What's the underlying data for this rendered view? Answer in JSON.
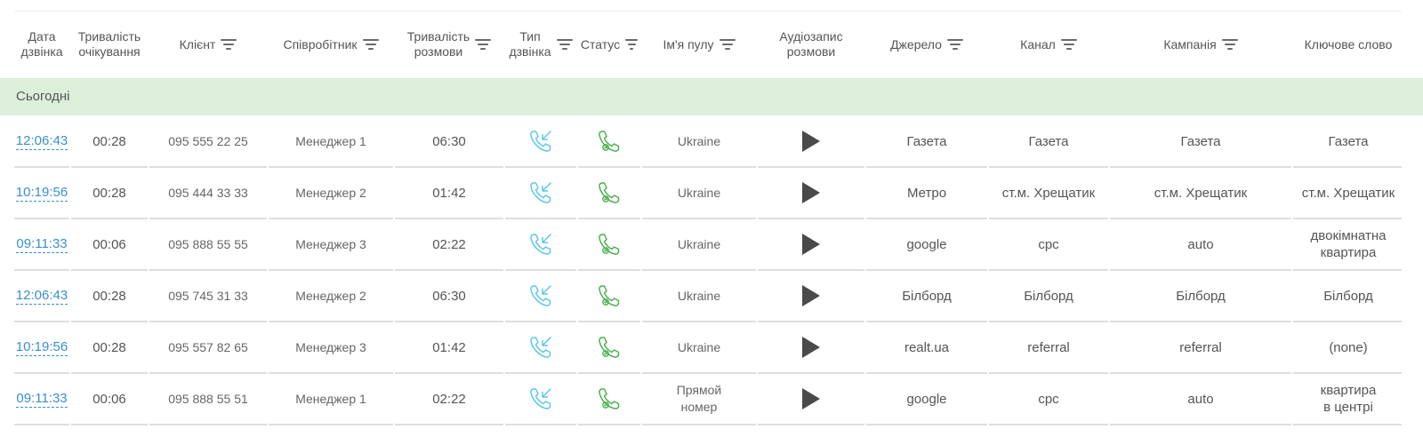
{
  "header": {
    "columns": [
      {
        "key": "call_date",
        "label": "Дата\nдзвінка",
        "filter_icon": "filter-icon",
        "has_filter": false
      },
      {
        "key": "wait_duration",
        "label": "Тривалість\nочікування",
        "has_filter": false
      },
      {
        "key": "client",
        "label": "Клієнт",
        "has_filter": true
      },
      {
        "key": "employee",
        "label": "Співробітник",
        "has_filter": true
      },
      {
        "key": "talk_duration",
        "label": "Тривалість\nрозмови",
        "has_filter": true
      },
      {
        "key": "call_type",
        "label": "Тип\nдзвінка",
        "has_filter": true
      },
      {
        "key": "status",
        "label": "Статус",
        "has_filter": true
      },
      {
        "key": "pool_name",
        "label": "Ім'я пулу",
        "has_filter": true
      },
      {
        "key": "recording",
        "label": "Аудіозапис\nрозмови",
        "has_filter": false
      },
      {
        "key": "source",
        "label": "Джерело",
        "has_filter": true
      },
      {
        "key": "channel",
        "label": "Канал",
        "has_filter": true
      },
      {
        "key": "campaign",
        "label": "Кампанія",
        "has_filter": true
      },
      {
        "key": "keyword",
        "label": "Ключове слово",
        "has_filter": false
      }
    ]
  },
  "group": {
    "label": "Сьогодні",
    "color": "#dcefdb"
  },
  "colors": {
    "link": "#3a8fd0",
    "incoming_icon": "#5bc8e8",
    "answered_icon": "#4cb050",
    "play": "#4a4a4a"
  },
  "icons": {
    "call_type": "incoming-call-icon",
    "status": "answered-call-icon",
    "recording": "play-icon",
    "filter": "filter-icon"
  },
  "rows": [
    {
      "time": "12:06:43",
      "wait": "00:28",
      "client": "095 555 22 25",
      "employee": "Менеджер 1",
      "talk": "06:30",
      "pool": "Ukraine",
      "source": "Газета",
      "channel": "Газета",
      "campaign": "Газета",
      "keyword": "Газета"
    },
    {
      "time": "10:19:56",
      "wait": "00:28",
      "client": "095 444 33 33",
      "employee": "Менеджер 2",
      "talk": "01:42",
      "pool": "Ukraine",
      "source": "Метро",
      "channel": "ст.м. Хрещатик",
      "campaign": "ст.м. Хрещатик",
      "keyword": "ст.м. Хрещатик"
    },
    {
      "time": "09:11:33",
      "wait": "00:06",
      "client": "095 888 55 55",
      "employee": "Менеджер 3",
      "talk": "02:22",
      "pool": "Ukraine",
      "source": "google",
      "channel": "cpc",
      "campaign": "auto",
      "keyword": "двокімнатна\nквартира"
    },
    {
      "time": "12:06:43",
      "wait": "00:28",
      "client": "095 745 31 33",
      "employee": "Менеджер 2",
      "talk": "06:30",
      "pool": "Ukraine",
      "source": "Білборд",
      "channel": "Білборд",
      "campaign": "Білборд",
      "keyword": "Білборд"
    },
    {
      "time": "10:19:56",
      "wait": "00:28",
      "client": "095 557 82 65",
      "employee": "Менеджер 3",
      "talk": "01:42",
      "pool": "Ukraine",
      "source": "realt.ua",
      "channel": "referral",
      "campaign": "referral",
      "keyword": "(none)"
    },
    {
      "time": "09:11:33",
      "wait": "00:06",
      "client": "095 888 55 51",
      "employee": "Менеджер 1",
      "talk": "02:22",
      "pool": "Прямой\nномер",
      "source": "google",
      "channel": "cpc",
      "campaign": "auto",
      "keyword": "квартира\nв центрі"
    }
  ]
}
